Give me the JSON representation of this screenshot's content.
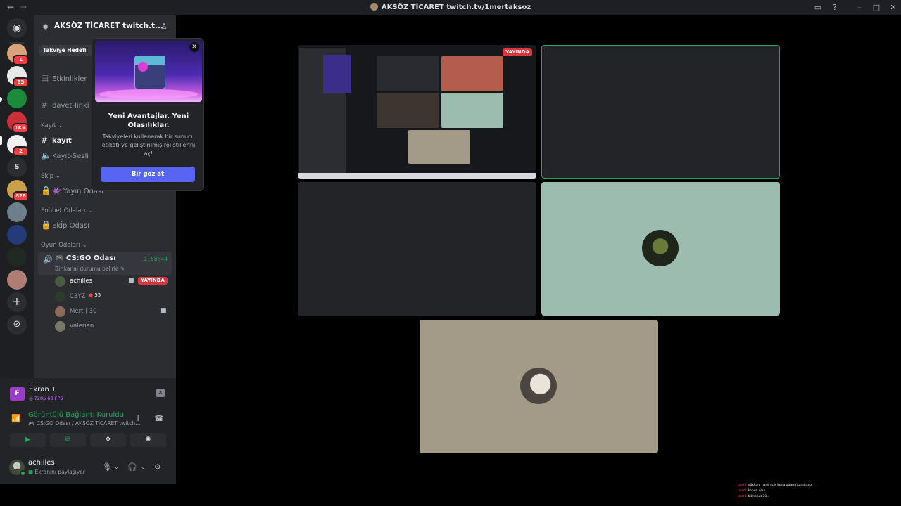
{
  "window": {
    "title": "AKSÖZ TİCARET twitch.tv/1mertaksoz"
  },
  "rail": {
    "badges": [
      "1",
      "83",
      "1K+",
      "2",
      "828"
    ],
    "text_server": "S"
  },
  "guild": {
    "name": "AKSÖZ TİCARET twitch.t...",
    "boost_label": "Takviye Hedefi"
  },
  "channels": {
    "events": "Etkinlikler",
    "invite_link": "davet-linki",
    "cat_kayit": "Kayıt",
    "kayit": "kayıt",
    "kayit_sesli": "Kayıt-Sesli",
    "cat_ekip": "Ekip",
    "yayin_odasi": "👾 Yayın Odası",
    "cat_sohbet": "Sohbet Odaları",
    "ekip_odasi": "Ekİp Odası",
    "cat_oyun": "Oyun Odaları",
    "voice": {
      "name": "🎮 CS:GO Odası",
      "time": "1:58:44",
      "status": "Bir kanal durumu belirle"
    }
  },
  "members": [
    {
      "name": "achilles",
      "live": "YAYINDA"
    },
    {
      "name": "C3YZ",
      "badge": "55"
    },
    {
      "name": "Mert | 30"
    },
    {
      "name": "valerian"
    }
  ],
  "popover": {
    "title": "Yeni Avantajlar. Yeni Olasılıklar.",
    "description": "Takviyeleri kullanarak bir sunucu etiketi ve geliştirilmiş rol stillerini aç!",
    "button": "Bir göz at"
  },
  "stream": {
    "name": "Ekran 1",
    "quality": "720p 60 FPS"
  },
  "rtc": {
    "status": "Görüntülü Bağlantı Kuruldu",
    "channel": "🎮 CS:GO Odası / AKSÖZ TİCARET twitch..."
  },
  "user": {
    "name": "achilles",
    "status": "Ekranını paylaşıyor"
  },
  "stage": {
    "live_label": "YAYINDA"
  },
  "chat": [
    {
      "user": "user1",
      "msg": "dükkanı nasıl açık kurla adamı kandırıyo"
    },
    {
      "user": "user2",
      "msg": "kenen olan"
    },
    {
      "user": "user3",
      "msg": "kıbrıs'tan30..."
    }
  ],
  "colors": {
    "accent": "#5865f2",
    "online": "#23a55a",
    "live": "#da373c"
  }
}
